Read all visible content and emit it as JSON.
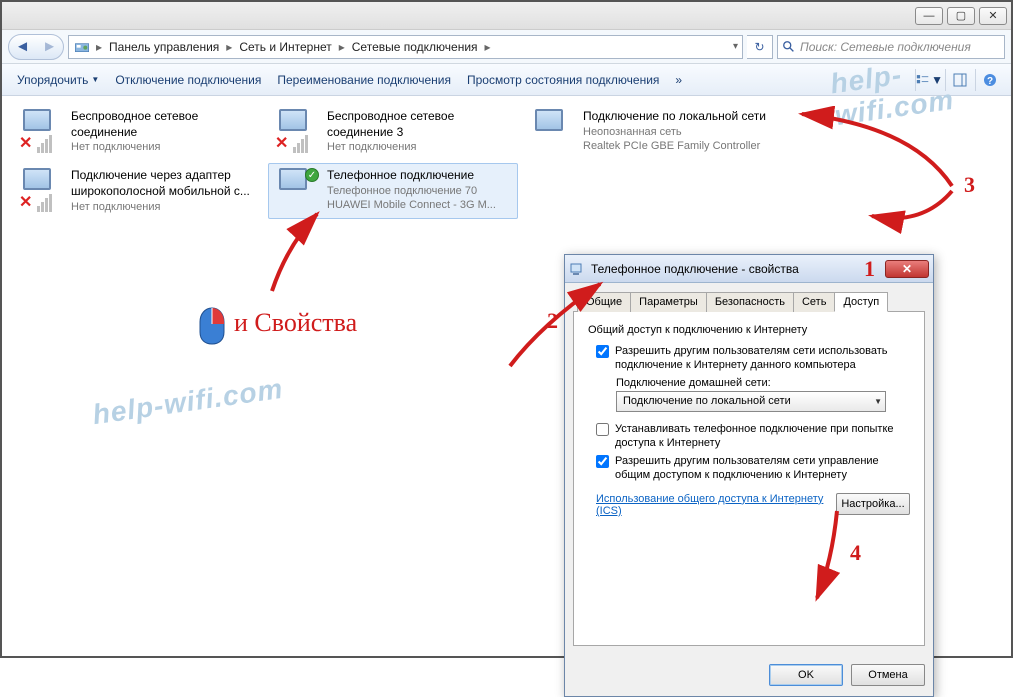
{
  "titlebar": {
    "min": "—",
    "max": "▢",
    "close": "✕"
  },
  "addressbar": {
    "segments": [
      "Панель управления",
      "Сеть и Интернет",
      "Сетевые подключения"
    ]
  },
  "search": {
    "placeholder": "Поиск: Сетевые подключения"
  },
  "toolbar": {
    "organize": "Упорядочить",
    "disable": "Отключение подключения",
    "rename": "Переименование подключения",
    "status": "Просмотр состояния подключения"
  },
  "connections": [
    {
      "title": "Беспроводное сетевое соединение",
      "line2": "Нет подключения",
      "line3": "",
      "wifi": true,
      "disabled": true
    },
    {
      "title": "Беспроводное сетевое соединение 3",
      "line2": "Нет подключения",
      "line3": "",
      "wifi": true,
      "disabled": true
    },
    {
      "title": "Подключение по локальной сети",
      "line2": "Неопознанная сеть",
      "line3": "Realtek PCIe GBE Family Controller",
      "wifi": false,
      "disabled": false
    },
    {
      "title": "Подключение через адаптер широкополосной мобильной с...",
      "line2": "Нет подключения",
      "line3": "",
      "wifi": true,
      "disabled": true
    },
    {
      "title": "Телефонное подключение",
      "line2": "Телефонное подключение 70",
      "line3": "HUAWEI Mobile Connect - 3G M...",
      "wifi": false,
      "disabled": false,
      "selected": true,
      "connected": true
    }
  ],
  "dialog": {
    "title": "Телефонное подключение - свойства",
    "tabs": [
      "Общие",
      "Параметры",
      "Безопасность",
      "Сеть",
      "Доступ"
    ],
    "activeTab": 4,
    "groupTitle": "Общий доступ к подключению к Интернету",
    "chk1": "Разрешить другим пользователям сети использовать подключение к Интернету данного компьютера",
    "homeNetLabel": "Подключение домашней сети:",
    "comboValue": "Подключение по локальной сети",
    "chk2": "Устанавливать телефонное подключение при попытке доступа к Интернету",
    "chk3": "Разрешить другим пользователям сети управление общим доступом к подключению к Интернету",
    "link": "Использование общего доступа к Интернету (ICS)",
    "settingsBtn": "Настройка...",
    "ok": "OK",
    "cancel": "Отмена"
  },
  "annotations": {
    "rightClick": "и Свойства",
    "n1": "1",
    "n2": "2",
    "n3": "3",
    "n4": "4"
  },
  "watermark": "help-wifi.com"
}
